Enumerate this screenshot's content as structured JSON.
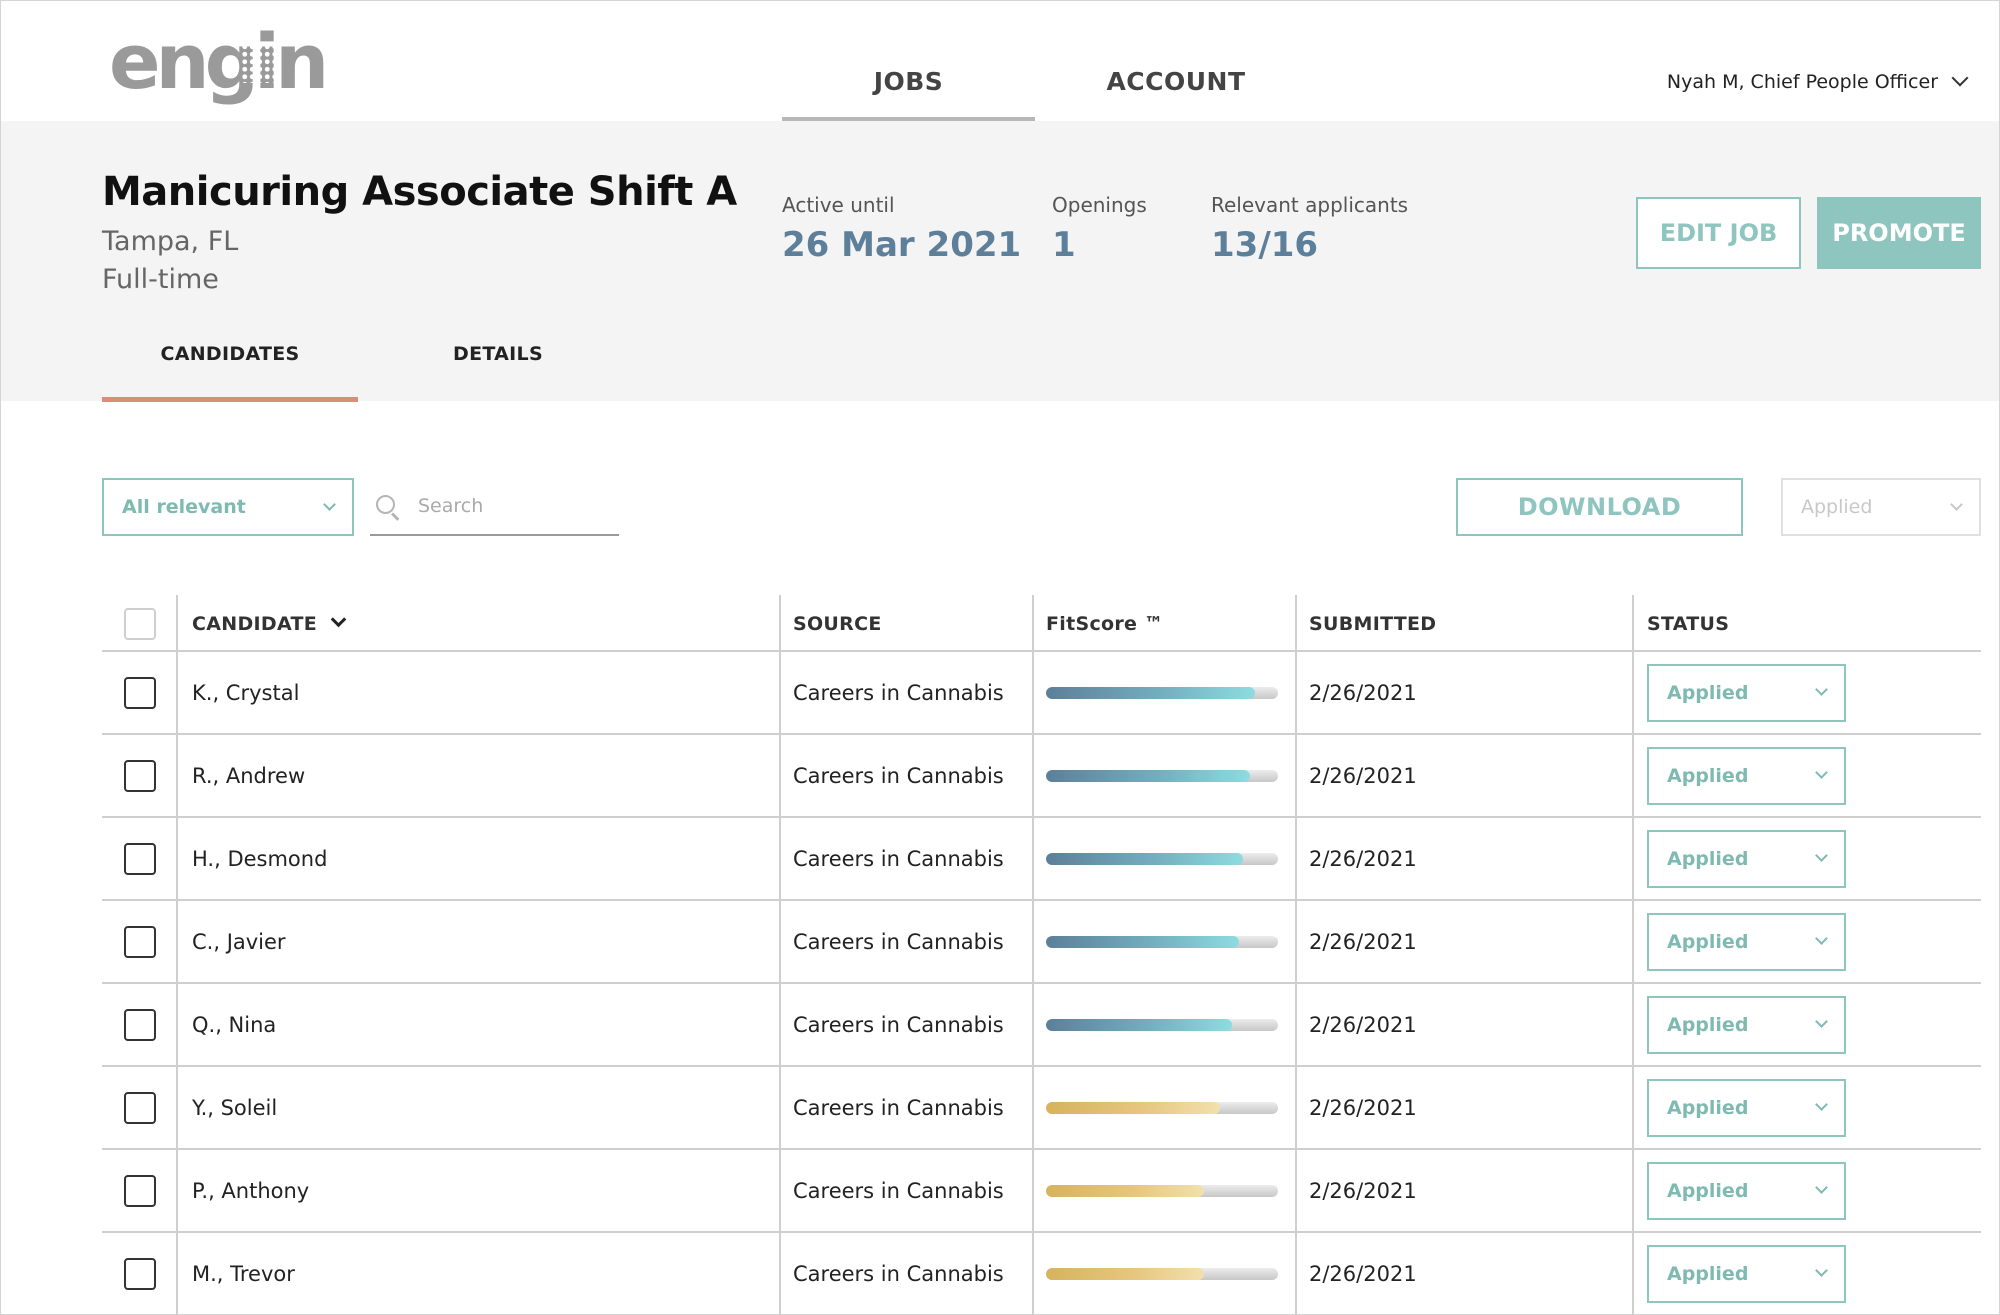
{
  "brand": {
    "logo_text": "engin",
    "accent": "#8ec5be",
    "stat_color": "#5d7f99",
    "tab_underline": "#d88e7a"
  },
  "nav": {
    "tabs": [
      {
        "label": "JOBS",
        "active": true
      },
      {
        "label": "ACCOUNT",
        "active": false
      }
    ],
    "user": "Nyah M, Chief People Officer"
  },
  "job": {
    "title": "Manicuring Associate Shift A",
    "location": "Tampa, FL",
    "type": "Full-time",
    "stats": {
      "active_label": "Active until",
      "active_value": "26 Mar 2021",
      "openings_label": "Openings",
      "openings_value": "1",
      "relevant_label": "Relevant applicants",
      "relevant_value": "13/16"
    },
    "edit_label": "EDIT JOB",
    "promote_label": "PROMOTE",
    "subtabs": [
      {
        "label": "CANDIDATES",
        "active": true
      },
      {
        "label": "DETAILS",
        "active": false
      }
    ]
  },
  "toolbar": {
    "filter_value": "All relevant",
    "search_placeholder": "Search",
    "download_label": "DOWNLOAD",
    "bulk_status": "Applied"
  },
  "table": {
    "headers": {
      "candidate": "CANDIDATE",
      "source": "SOURCE",
      "fitscore": "FitScore ™",
      "submitted": "SUBMITTED",
      "status": "STATUS"
    },
    "rows": [
      {
        "name": "K., Crystal",
        "source": "Careers in Cannabis",
        "fit": 0.9,
        "tier": "blue",
        "submitted": "2/26/2021",
        "status": "Applied"
      },
      {
        "name": "R., Andrew",
        "source": "Careers in Cannabis",
        "fit": 0.88,
        "tier": "blue",
        "submitted": "2/26/2021",
        "status": "Applied"
      },
      {
        "name": "H., Desmond",
        "source": "Careers in Cannabis",
        "fit": 0.85,
        "tier": "blue",
        "submitted": "2/26/2021",
        "status": "Applied"
      },
      {
        "name": "C., Javier",
        "source": "Careers in Cannabis",
        "fit": 0.83,
        "tier": "blue",
        "submitted": "2/26/2021",
        "status": "Applied"
      },
      {
        "name": "Q., Nina",
        "source": "Careers in Cannabis",
        "fit": 0.8,
        "tier": "blue",
        "submitted": "2/26/2021",
        "status": "Applied"
      },
      {
        "name": "Y., Soleil",
        "source": "Careers in Cannabis",
        "fit": 0.75,
        "tier": "gold",
        "submitted": "2/26/2021",
        "status": "Applied"
      },
      {
        "name": "P., Anthony",
        "source": "Careers in Cannabis",
        "fit": 0.68,
        "tier": "gold",
        "submitted": "2/26/2021",
        "status": "Applied"
      },
      {
        "name": "M., Trevor",
        "source": "Careers in Cannabis",
        "fit": 0.68,
        "tier": "gold",
        "submitted": "2/26/2021",
        "status": "Applied"
      }
    ]
  }
}
